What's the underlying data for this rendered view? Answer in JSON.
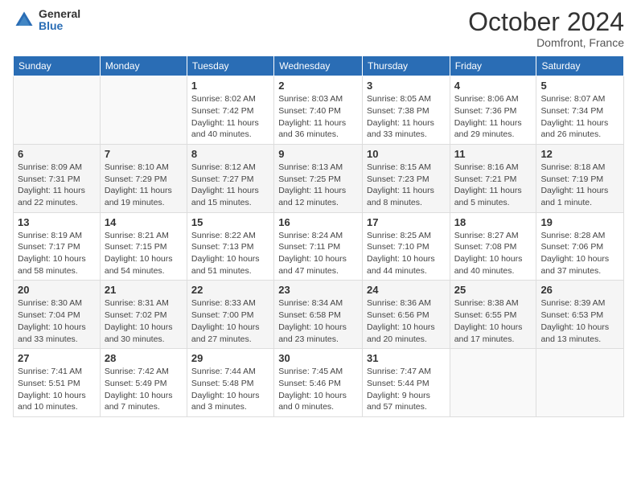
{
  "logo": {
    "general": "General",
    "blue": "Blue"
  },
  "title": "October 2024",
  "subtitle": "Domfront, France",
  "days_of_week": [
    "Sunday",
    "Monday",
    "Tuesday",
    "Wednesday",
    "Thursday",
    "Friday",
    "Saturday"
  ],
  "weeks": [
    [
      {
        "day": "",
        "info": ""
      },
      {
        "day": "",
        "info": ""
      },
      {
        "day": "1",
        "info": "Sunrise: 8:02 AM\nSunset: 7:42 PM\nDaylight: 11 hours and 40 minutes."
      },
      {
        "day": "2",
        "info": "Sunrise: 8:03 AM\nSunset: 7:40 PM\nDaylight: 11 hours and 36 minutes."
      },
      {
        "day": "3",
        "info": "Sunrise: 8:05 AM\nSunset: 7:38 PM\nDaylight: 11 hours and 33 minutes."
      },
      {
        "day": "4",
        "info": "Sunrise: 8:06 AM\nSunset: 7:36 PM\nDaylight: 11 hours and 29 minutes."
      },
      {
        "day": "5",
        "info": "Sunrise: 8:07 AM\nSunset: 7:34 PM\nDaylight: 11 hours and 26 minutes."
      }
    ],
    [
      {
        "day": "6",
        "info": "Sunrise: 8:09 AM\nSunset: 7:31 PM\nDaylight: 11 hours and 22 minutes."
      },
      {
        "day": "7",
        "info": "Sunrise: 8:10 AM\nSunset: 7:29 PM\nDaylight: 11 hours and 19 minutes."
      },
      {
        "day": "8",
        "info": "Sunrise: 8:12 AM\nSunset: 7:27 PM\nDaylight: 11 hours and 15 minutes."
      },
      {
        "day": "9",
        "info": "Sunrise: 8:13 AM\nSunset: 7:25 PM\nDaylight: 11 hours and 12 minutes."
      },
      {
        "day": "10",
        "info": "Sunrise: 8:15 AM\nSunset: 7:23 PM\nDaylight: 11 hours and 8 minutes."
      },
      {
        "day": "11",
        "info": "Sunrise: 8:16 AM\nSunset: 7:21 PM\nDaylight: 11 hours and 5 minutes."
      },
      {
        "day": "12",
        "info": "Sunrise: 8:18 AM\nSunset: 7:19 PM\nDaylight: 11 hours and 1 minute."
      }
    ],
    [
      {
        "day": "13",
        "info": "Sunrise: 8:19 AM\nSunset: 7:17 PM\nDaylight: 10 hours and 58 minutes."
      },
      {
        "day": "14",
        "info": "Sunrise: 8:21 AM\nSunset: 7:15 PM\nDaylight: 10 hours and 54 minutes."
      },
      {
        "day": "15",
        "info": "Sunrise: 8:22 AM\nSunset: 7:13 PM\nDaylight: 10 hours and 51 minutes."
      },
      {
        "day": "16",
        "info": "Sunrise: 8:24 AM\nSunset: 7:11 PM\nDaylight: 10 hours and 47 minutes."
      },
      {
        "day": "17",
        "info": "Sunrise: 8:25 AM\nSunset: 7:10 PM\nDaylight: 10 hours and 44 minutes."
      },
      {
        "day": "18",
        "info": "Sunrise: 8:27 AM\nSunset: 7:08 PM\nDaylight: 10 hours and 40 minutes."
      },
      {
        "day": "19",
        "info": "Sunrise: 8:28 AM\nSunset: 7:06 PM\nDaylight: 10 hours and 37 minutes."
      }
    ],
    [
      {
        "day": "20",
        "info": "Sunrise: 8:30 AM\nSunset: 7:04 PM\nDaylight: 10 hours and 33 minutes."
      },
      {
        "day": "21",
        "info": "Sunrise: 8:31 AM\nSunset: 7:02 PM\nDaylight: 10 hours and 30 minutes."
      },
      {
        "day": "22",
        "info": "Sunrise: 8:33 AM\nSunset: 7:00 PM\nDaylight: 10 hours and 27 minutes."
      },
      {
        "day": "23",
        "info": "Sunrise: 8:34 AM\nSunset: 6:58 PM\nDaylight: 10 hours and 23 minutes."
      },
      {
        "day": "24",
        "info": "Sunrise: 8:36 AM\nSunset: 6:56 PM\nDaylight: 10 hours and 20 minutes."
      },
      {
        "day": "25",
        "info": "Sunrise: 8:38 AM\nSunset: 6:55 PM\nDaylight: 10 hours and 17 minutes."
      },
      {
        "day": "26",
        "info": "Sunrise: 8:39 AM\nSunset: 6:53 PM\nDaylight: 10 hours and 13 minutes."
      }
    ],
    [
      {
        "day": "27",
        "info": "Sunrise: 7:41 AM\nSunset: 5:51 PM\nDaylight: 10 hours and 10 minutes."
      },
      {
        "day": "28",
        "info": "Sunrise: 7:42 AM\nSunset: 5:49 PM\nDaylight: 10 hours and 7 minutes."
      },
      {
        "day": "29",
        "info": "Sunrise: 7:44 AM\nSunset: 5:48 PM\nDaylight: 10 hours and 3 minutes."
      },
      {
        "day": "30",
        "info": "Sunrise: 7:45 AM\nSunset: 5:46 PM\nDaylight: 10 hours and 0 minutes."
      },
      {
        "day": "31",
        "info": "Sunrise: 7:47 AM\nSunset: 5:44 PM\nDaylight: 9 hours and 57 minutes."
      },
      {
        "day": "",
        "info": ""
      },
      {
        "day": "",
        "info": ""
      }
    ]
  ]
}
